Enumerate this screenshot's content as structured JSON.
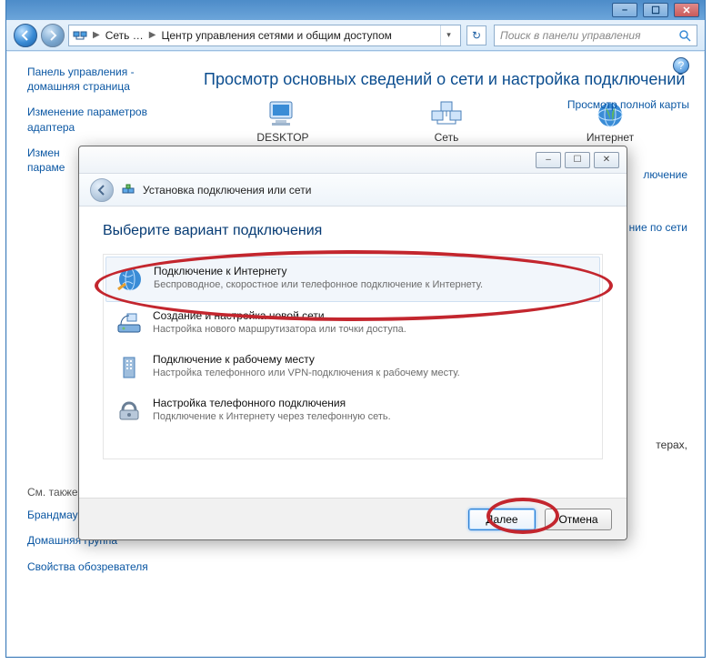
{
  "window": {
    "breadcrumb": {
      "root": "Сеть …",
      "leaf": "Центр управления сетями и общим доступом"
    },
    "search_placeholder": "Поиск в панели управления"
  },
  "sidebar": {
    "home": "Панель управления - домашняя страница",
    "items": [
      "Изменение параметров адаптера",
      "Измен\nпараме"
    ],
    "see_also_label": "См. также",
    "see_also": [
      "Брандмауэр Windows",
      "Домашняя группа",
      "Свойства обозревателя"
    ]
  },
  "main": {
    "title": "Просмотр основных сведений о сети и настройка подключений",
    "map_link": "Просмотр полной карты",
    "nodes": {
      "desktop": "DESKTOP",
      "network": "Сеть",
      "internet": "Интернет"
    },
    "frag_links": [
      "лючение",
      "ние по сети",
      "терах,"
    ]
  },
  "wizard": {
    "title": "Установка подключения или сети",
    "heading": "Выберите вариант подключения",
    "options": [
      {
        "title": "Подключение к Интернету",
        "desc": "Беспроводное, скоростное или телефонное подключение к Интернету."
      },
      {
        "title": "Создание и настройка новой сети",
        "desc": "Настройка нового маршрутизатора или точки доступа."
      },
      {
        "title": "Подключение к рабочему месту",
        "desc": "Настройка телефонного или VPN-подключения к рабочему месту."
      },
      {
        "title": "Настройка телефонного подключения",
        "desc": "Подключение к Интернету через телефонную сеть."
      }
    ],
    "next": "Далее",
    "cancel": "Отмена"
  }
}
